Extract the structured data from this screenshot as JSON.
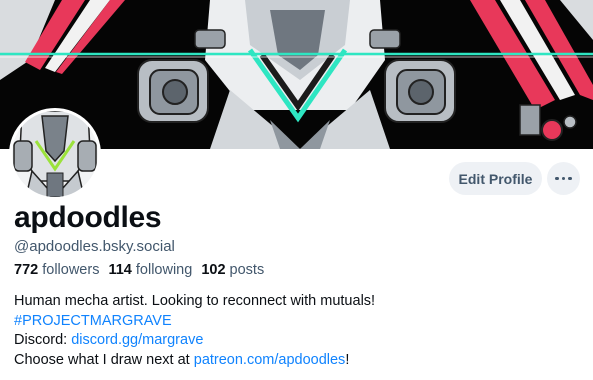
{
  "profile": {
    "display_name": "apdoodles",
    "handle": "@apdoodles.bsky.social",
    "followers_count": "772",
    "followers_label": "followers",
    "following_count": "114",
    "following_label": "following",
    "posts_count": "102",
    "posts_label": "posts"
  },
  "actions": {
    "edit_profile": "Edit Profile",
    "more_icon": "ellipsis-icon"
  },
  "bio": {
    "line1": "Human mecha artist. Looking to reconnect with mutuals!",
    "hashtag": "#PROJECTMARGRAVE",
    "discord_prefix": "Discord: ",
    "discord_link": "discord.gg/margrave",
    "patreon_prefix": "Choose what I draw next at ",
    "patreon_link": "patreon.com/apdoodles",
    "patreon_suffix": "!"
  },
  "colors": {
    "link": "#1083fe",
    "muted_text": "#42576c",
    "button_bg": "#eef1f5",
    "banner_accent": "#2ee6c2",
    "banner_red": "#e8385a"
  },
  "images": {
    "banner": "mecha-artwork-banner",
    "avatar": "mecha-head-avatar"
  }
}
